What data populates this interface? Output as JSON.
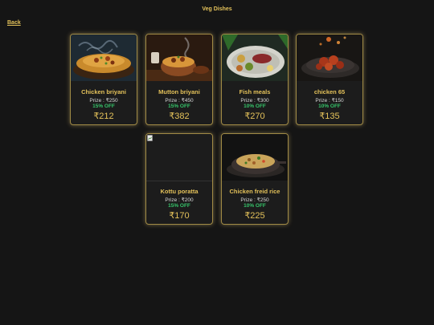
{
  "header": {
    "title": "Veg Dishes"
  },
  "nav": {
    "back_label": "Back"
  },
  "dishes": [
    {
      "name": "Chicken briyani",
      "prize": "Prize : ₹250",
      "off": "15% OFF",
      "price": "₹212"
    },
    {
      "name": "Mutton briyani",
      "prize": "Prize : ₹450",
      "off": "15% OFF",
      "price": "₹382"
    },
    {
      "name": "Fish meals",
      "prize": "Prize : ₹300",
      "off": "10% OFF",
      "price": "₹270"
    },
    {
      "name": "chicken 65",
      "prize": "Prize : ₹150",
      "off": "10% OFF",
      "price": "₹135"
    },
    {
      "name": "Kottu poratta",
      "prize": "Prize : ₹200",
      "off": "15% OFF",
      "price": "₹170"
    },
    {
      "name": "Chicken freid rice",
      "prize": "Prize : ₹250",
      "off": "10% OFF",
      "price": "₹225"
    }
  ],
  "colors": {
    "accent": "#e3c15a",
    "discount": "#36c46a",
    "background": "#151515",
    "card": "#1c1c1c"
  }
}
